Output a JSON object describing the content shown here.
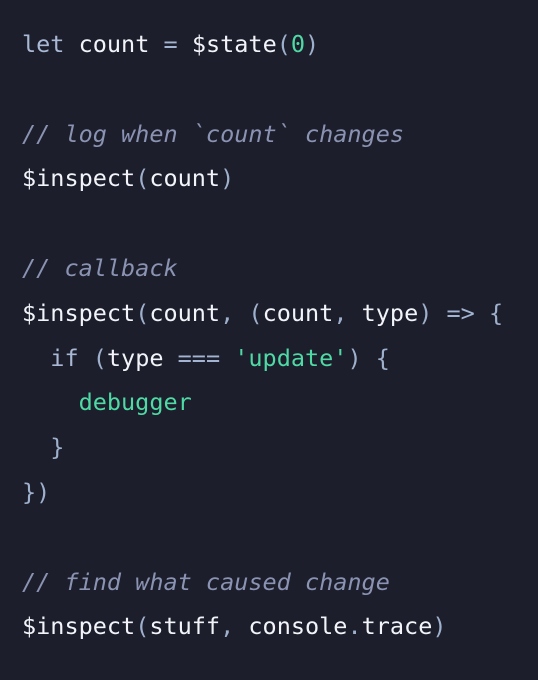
{
  "editor": {
    "background_color": "#1c1e2b",
    "language": "javascript",
    "font_size_px": 23.5,
    "line_height_px": 44.8
  },
  "theme": {
    "keyword_color": "#a9b8d4",
    "plain_color": "#f2f4f9",
    "punctuation_color": "#9fb0cc",
    "operator_color": "#a3b4d2",
    "comment_color": "#8b93b3",
    "string_color": "#4fd9a4",
    "number_color": "#4fd9a4",
    "debugger_color": "#4fd9a4"
  },
  "code": {
    "lines": [
      {
        "index": 0,
        "text": "let count = $state(0)",
        "tokens": [
          {
            "t": "let",
            "k": "keyword"
          },
          {
            "t": " ",
            "k": "plain"
          },
          {
            "t": "count",
            "k": "plain"
          },
          {
            "t": " ",
            "k": "plain"
          },
          {
            "t": "=",
            "k": "operator"
          },
          {
            "t": " ",
            "k": "plain"
          },
          {
            "t": "$state",
            "k": "func"
          },
          {
            "t": "(",
            "k": "punct"
          },
          {
            "t": "0",
            "k": "number"
          },
          {
            "t": ")",
            "k": "punct"
          }
        ]
      },
      {
        "index": 1,
        "text": "",
        "tokens": []
      },
      {
        "index": 2,
        "text": "// log when `count` changes",
        "tokens": [
          {
            "t": "// log when `count` changes",
            "k": "comment"
          }
        ]
      },
      {
        "index": 3,
        "text": "$inspect(count)",
        "tokens": [
          {
            "t": "$inspect",
            "k": "func"
          },
          {
            "t": "(",
            "k": "punct"
          },
          {
            "t": "count",
            "k": "plain"
          },
          {
            "t": ")",
            "k": "punct"
          }
        ]
      },
      {
        "index": 4,
        "text": "",
        "tokens": []
      },
      {
        "index": 5,
        "text": "// callback",
        "tokens": [
          {
            "t": "// callback",
            "k": "comment"
          }
        ]
      },
      {
        "index": 6,
        "text": "$inspect(count, (count, type) => {",
        "tokens": [
          {
            "t": "$inspect",
            "k": "func"
          },
          {
            "t": "(",
            "k": "punct"
          },
          {
            "t": "count",
            "k": "plain"
          },
          {
            "t": ",",
            "k": "punct"
          },
          {
            "t": " ",
            "k": "plain"
          },
          {
            "t": "(",
            "k": "punct"
          },
          {
            "t": "count",
            "k": "plain"
          },
          {
            "t": ",",
            "k": "punct"
          },
          {
            "t": " ",
            "k": "plain"
          },
          {
            "t": "type",
            "k": "plain"
          },
          {
            "t": ")",
            "k": "punct"
          },
          {
            "t": " ",
            "k": "plain"
          },
          {
            "t": "=>",
            "k": "operator"
          },
          {
            "t": " ",
            "k": "plain"
          },
          {
            "t": "{",
            "k": "punct"
          }
        ]
      },
      {
        "index": 7,
        "text": "  if (type === 'update') {",
        "tokens": [
          {
            "t": "  ",
            "k": "plain"
          },
          {
            "t": "if",
            "k": "keyword"
          },
          {
            "t": " ",
            "k": "plain"
          },
          {
            "t": "(",
            "k": "punct"
          },
          {
            "t": "type",
            "k": "plain"
          },
          {
            "t": " ",
            "k": "plain"
          },
          {
            "t": "===",
            "k": "operator"
          },
          {
            "t": " ",
            "k": "plain"
          },
          {
            "t": "'update'",
            "k": "string"
          },
          {
            "t": ")",
            "k": "punct"
          },
          {
            "t": " ",
            "k": "plain"
          },
          {
            "t": "{",
            "k": "punct"
          }
        ]
      },
      {
        "index": 8,
        "text": "    debugger",
        "tokens": [
          {
            "t": "    ",
            "k": "plain"
          },
          {
            "t": "debugger",
            "k": "debug"
          }
        ]
      },
      {
        "index": 9,
        "text": "  }",
        "tokens": [
          {
            "t": "  ",
            "k": "plain"
          },
          {
            "t": "}",
            "k": "punct"
          }
        ]
      },
      {
        "index": 10,
        "text": "})",
        "tokens": [
          {
            "t": "}",
            "k": "punct"
          },
          {
            "t": ")",
            "k": "punct"
          }
        ]
      },
      {
        "index": 11,
        "text": "",
        "tokens": []
      },
      {
        "index": 12,
        "text": "// find what caused change",
        "tokens": [
          {
            "t": "// find what caused change",
            "k": "comment"
          }
        ]
      },
      {
        "index": 13,
        "text": "$inspect(stuff, console.trace)",
        "tokens": [
          {
            "t": "$inspect",
            "k": "func"
          },
          {
            "t": "(",
            "k": "punct"
          },
          {
            "t": "stuff",
            "k": "plain"
          },
          {
            "t": ",",
            "k": "punct"
          },
          {
            "t": " ",
            "k": "plain"
          },
          {
            "t": "console",
            "k": "plain"
          },
          {
            "t": ".",
            "k": "punct"
          },
          {
            "t": "trace",
            "k": "plain"
          },
          {
            "t": ")",
            "k": "punct"
          }
        ]
      }
    ]
  }
}
